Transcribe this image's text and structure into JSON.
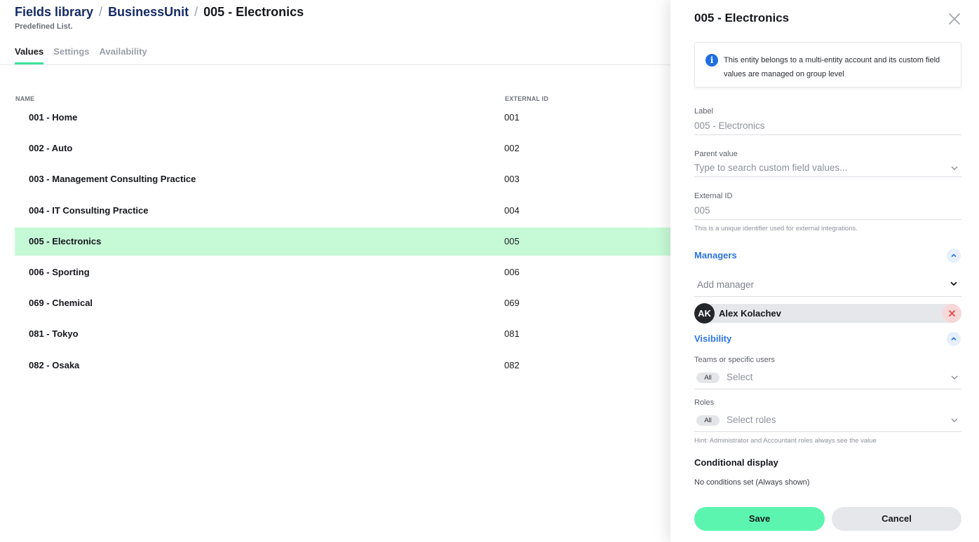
{
  "breadcrumb": {
    "root": "Fields library",
    "parent": "BusinessUnit",
    "current": "005 - Electronics",
    "separator": "/"
  },
  "subtitle": "Predefined List.",
  "tabs": [
    {
      "label": "Values",
      "active": true
    },
    {
      "label": "Settings",
      "active": false
    },
    {
      "label": "Availability",
      "active": false
    }
  ],
  "table": {
    "columns": [
      "NAME",
      "EXTERNAL ID"
    ],
    "rows": [
      {
        "name": "001 - Home",
        "external_id": "001",
        "selected": false
      },
      {
        "name": "002 - Auto",
        "external_id": "002",
        "selected": false
      },
      {
        "name": "003 - Management Consulting Practice",
        "external_id": "003",
        "selected": false
      },
      {
        "name": "004 - IT Consulting Practice",
        "external_id": "004",
        "selected": false
      },
      {
        "name": "005 - Electronics",
        "external_id": "005",
        "selected": true
      },
      {
        "name": "006 - Sporting",
        "external_id": "006",
        "selected": false
      },
      {
        "name": "069 - Chemical",
        "external_id": "069",
        "selected": false
      },
      {
        "name": "081 - Tokyo",
        "external_id": "081",
        "selected": false
      },
      {
        "name": "082 - Osaka",
        "external_id": "082",
        "selected": false
      }
    ]
  },
  "drawer": {
    "title": "005 - Electronics",
    "info": "This entity belongs to a multi-entity account and its custom field values are managed on group level",
    "label_field": {
      "label": "Label",
      "value": "005 - Electronics"
    },
    "parent_field": {
      "label": "Parent value",
      "placeholder": "Type to search custom field values..."
    },
    "external_field": {
      "label": "External ID",
      "value": "005",
      "help": "This is a unique identifier used for external integrations."
    },
    "managers": {
      "title": "Managers",
      "add_placeholder": "Add manager",
      "items": [
        {
          "initials": "AK",
          "name": "Alex Kolachev"
        }
      ]
    },
    "visibility": {
      "title": "Visibility",
      "teams": {
        "label": "Teams or specific users",
        "pill": "All",
        "placeholder": "Select"
      },
      "roles": {
        "label": "Roles",
        "pill": "All",
        "placeholder": "Select roles"
      },
      "hint": "Hint: Administrator and Accountant roles always see the value"
    },
    "conditional": {
      "title": "Conditional display",
      "text": "No conditions set (Always shown)"
    },
    "save_label": "Save",
    "cancel_label": "Cancel"
  },
  "colors": {
    "accent": "#3fe39a",
    "selected_row": "#c6fad7",
    "save_button": "#5cf5b0",
    "link_blue": "#2b74e0",
    "breadcrumb_navy": "#162b66",
    "remove_red": "#e5484d"
  },
  "icons": [
    "info-icon",
    "close-icon",
    "chevron-down-icon",
    "chevron-up-icon",
    "remove-icon"
  ]
}
